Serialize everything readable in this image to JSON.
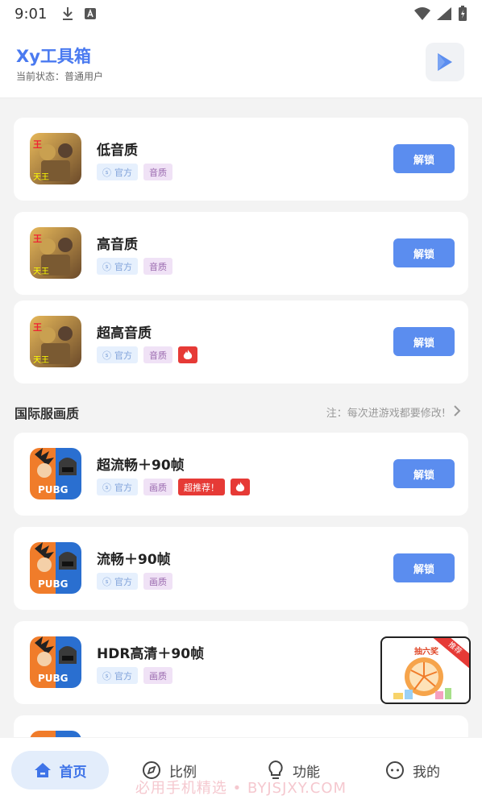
{
  "status_bar": {
    "time": "9:01"
  },
  "header": {
    "title": "Xy工具箱",
    "subtitle": "当前状态：普通用户"
  },
  "cards_top": [
    {
      "title": "低音质",
      "tags": [
        "官方",
        "音质"
      ],
      "hot_fire": false,
      "button": "解锁"
    },
    {
      "title": "高音质",
      "tags": [
        "官方",
        "音质"
      ],
      "hot_fire": false,
      "button": "解锁"
    },
    {
      "title": "超高音质",
      "tags": [
        "官方",
        "音质"
      ],
      "hot_fire": true,
      "button": "解锁"
    }
  ],
  "section": {
    "title": "国际服画质",
    "note": "注：每次进游戏都要修改!"
  },
  "cards_bottom": [
    {
      "title": "超流畅＋90帧",
      "tags": [
        "官方",
        "画质"
      ],
      "badge": "超推荐！",
      "hot_fire": true,
      "button": "解锁"
    },
    {
      "title": "流畅＋90帧",
      "tags": [
        "官方",
        "画质"
      ],
      "hot_fire": false,
      "button": "解锁"
    },
    {
      "title": "HDR高清＋90帧",
      "tags": [
        "官方",
        "画质"
      ],
      "hot_fire": false
    }
  ],
  "float_ad": {
    "title": "抽六奖",
    "ribbon": "推荐"
  },
  "bottom_nav": [
    {
      "label": "首页",
      "icon": "home-icon",
      "active": true
    },
    {
      "label": "比例",
      "icon": "compass-icon",
      "active": false
    },
    {
      "label": "功能",
      "icon": "lightbulb-icon",
      "active": false
    },
    {
      "label": "我的",
      "icon": "face-icon",
      "active": false
    }
  ],
  "watermark": "必用手机精选 • BYJSJXY.COM",
  "colors": {
    "accent": "#5b8def",
    "title_blue": "#4a7af0",
    "hot_red": "#e63a36"
  }
}
